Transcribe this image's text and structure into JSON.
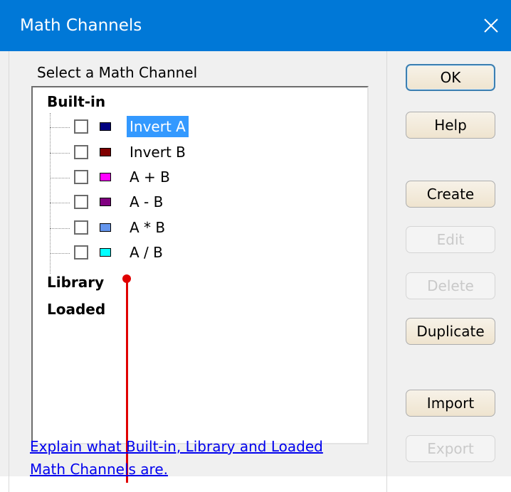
{
  "window": {
    "title": "Math Channels",
    "close_icon": "close-icon"
  },
  "group": {
    "caption": "Select a Math Channel"
  },
  "tree": {
    "nodes": {
      "builtin": "Built-in",
      "library": "Library",
      "loaded": "Loaded"
    },
    "items": [
      {
        "label": "Invert A",
        "color": "#000080",
        "checked": false,
        "selected": true
      },
      {
        "label": "Invert B",
        "color": "#800000",
        "checked": false,
        "selected": false
      },
      {
        "label": "A + B",
        "color": "#ff00ff",
        "checked": false,
        "selected": false
      },
      {
        "label": "A - B",
        "color": "#800080",
        "checked": false,
        "selected": false
      },
      {
        "label": "A * B",
        "color": "#6495ed",
        "checked": false,
        "selected": false
      },
      {
        "label": "A / B",
        "color": "#00ffff",
        "checked": false,
        "selected": false
      }
    ]
  },
  "link": {
    "text": "Explain what Built-in, Library and Loaded Math Channels are."
  },
  "buttons": {
    "ok": {
      "label": "OK",
      "enabled": true
    },
    "help": {
      "label": "Help",
      "enabled": true
    },
    "create": {
      "label": "Create",
      "enabled": true
    },
    "edit": {
      "label": "Edit",
      "enabled": false
    },
    "delete": {
      "label": "Delete",
      "enabled": false
    },
    "duplicate": {
      "label": "Duplicate",
      "enabled": true
    },
    "import": {
      "label": "Import",
      "enabled": true
    },
    "export": {
      "label": "Export",
      "enabled": false
    }
  },
  "colors": {
    "titlebar": "#0078d7",
    "selection": "#3399ff",
    "link": "#0000ee",
    "pointer": "#e00000"
  }
}
